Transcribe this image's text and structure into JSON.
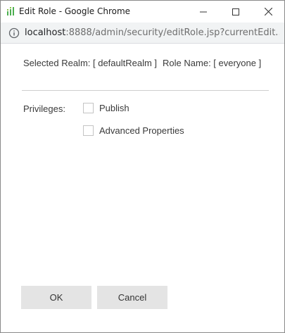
{
  "window": {
    "title": "Edit Role - Google Chrome"
  },
  "address_bar": {
    "host": "localhost",
    "path": ":8888/admin/security/editRole.jsp?currentEdit..."
  },
  "dialog": {
    "selected_realm_text": "Selected Realm: [ defaultRealm ]",
    "role_name_text": "Role Name: [ everyone ]",
    "privileges_label": "Privileges:",
    "privileges": [
      {
        "label": "Publish",
        "checked": false
      },
      {
        "label": "Advanced Properties",
        "checked": false
      }
    ],
    "ok_label": "OK",
    "cancel_label": "Cancel"
  },
  "colors": {
    "icon_green": "#4caf50",
    "button_bg": "#e4e4e4"
  }
}
